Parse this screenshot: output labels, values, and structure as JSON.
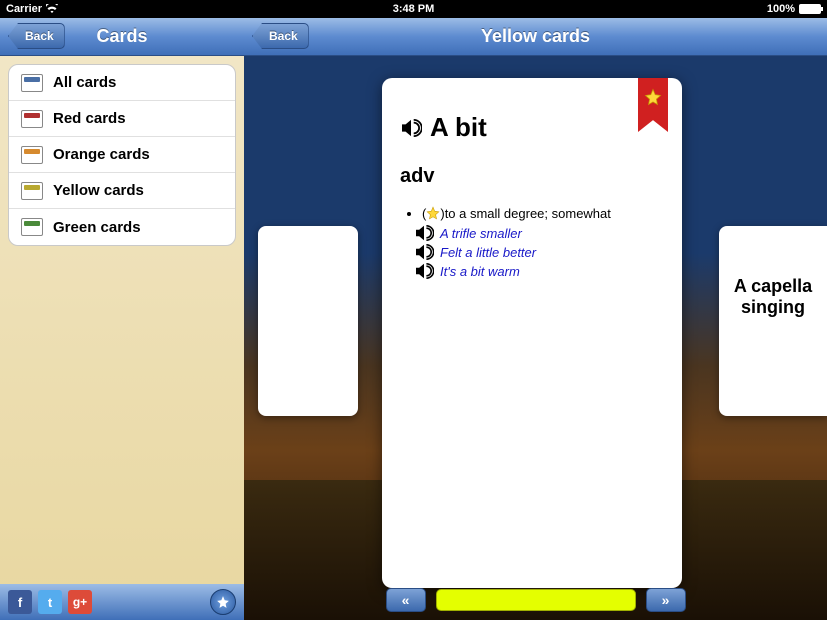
{
  "status": {
    "carrier": "Carrier",
    "time": "3:48 PM",
    "battery": "100%"
  },
  "sidebar": {
    "title": "Cards",
    "back": "Back",
    "items": [
      {
        "label": "All cards",
        "icon": "all"
      },
      {
        "label": "Red cards",
        "icon": "red"
      },
      {
        "label": "Orange cards",
        "icon": "orange"
      },
      {
        "label": "Yellow cards",
        "icon": "yellow"
      },
      {
        "label": "Green cards",
        "icon": "green"
      }
    ]
  },
  "detail": {
    "title": "Yellow cards",
    "back": "Back",
    "prev_label": "«",
    "next_label": "»"
  },
  "card": {
    "word": "A bit",
    "pos": "adv",
    "definition": "to a small degree; somewhat",
    "paren_open": "(",
    "paren_close": ")",
    "examples": [
      "A trifle smaller",
      "Felt a little better",
      "It's a bit warm"
    ]
  },
  "next_card": {
    "word": "A capella singing"
  },
  "social": {
    "fb": "f",
    "tw": "t",
    "gp": "g+"
  }
}
